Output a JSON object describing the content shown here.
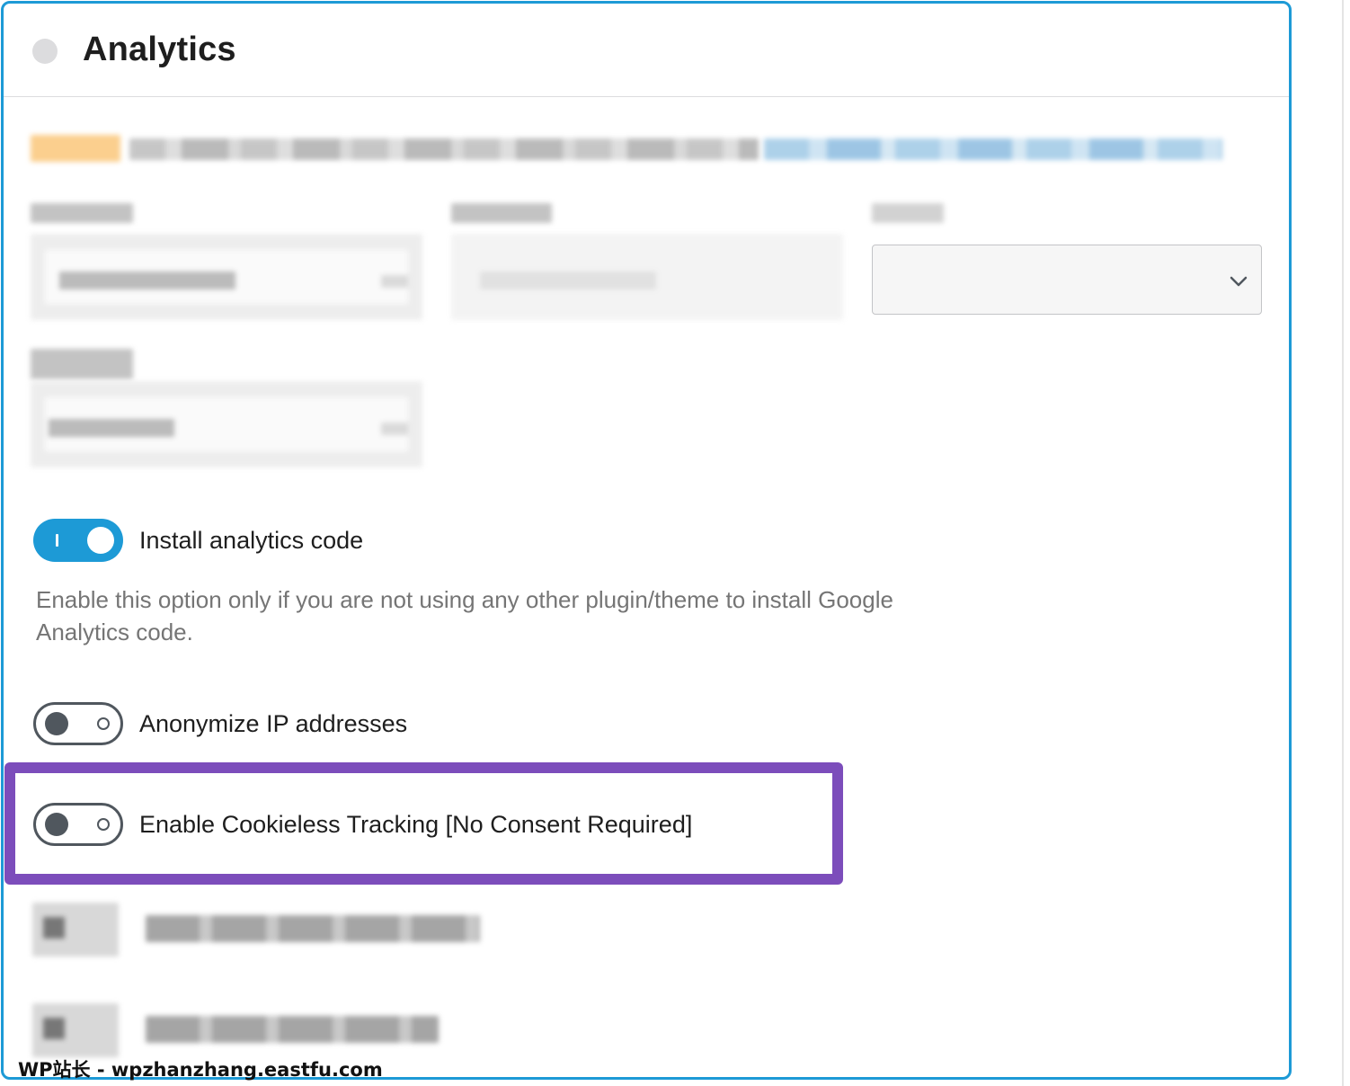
{
  "section": {
    "title": "Analytics"
  },
  "options": {
    "install_code": {
      "label": "Install analytics code",
      "enabled": true,
      "help": "Enable this option only if you are not using any other plugin/theme to install Google Analytics code."
    },
    "anonymize_ip": {
      "label": "Anonymize IP addresses",
      "enabled": false
    },
    "cookieless": {
      "label": "Enable Cookieless Tracking [No Consent Required]",
      "enabled": false
    }
  },
  "colors": {
    "accent": "#1d9ad6",
    "highlight": "#7c4dbb",
    "toggle_off": "#50575e",
    "help_text": "#757575"
  },
  "icons": {
    "select": "chevron-down-icon",
    "status": "status-dot"
  },
  "watermark": "WP站长 - wpzhanzhang.eastfu.com"
}
